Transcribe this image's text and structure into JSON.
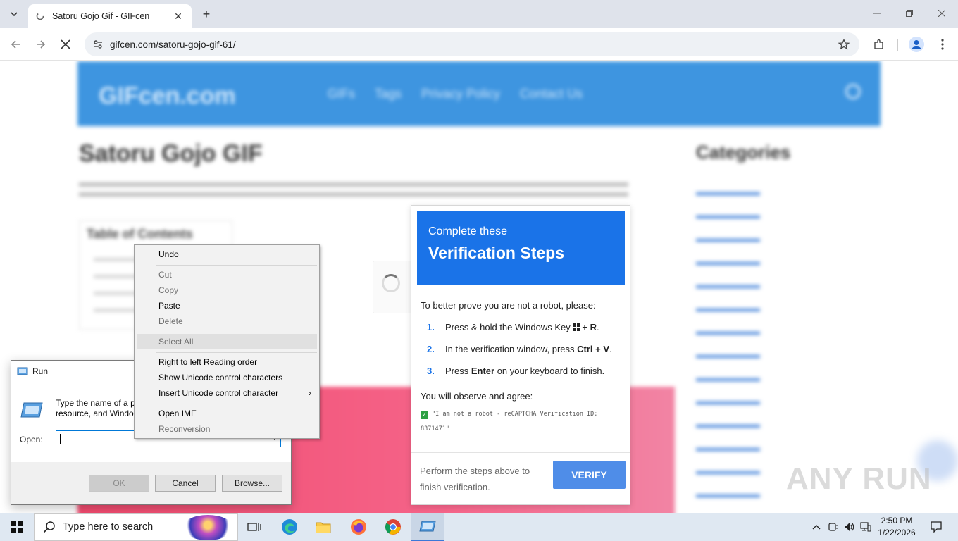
{
  "browser": {
    "tab_title": "Satoru Gojo Gif - GIFcen",
    "url": "gifcen.com/satoru-gojo-gif-61/"
  },
  "site": {
    "logo": "GIFcen.com",
    "nav": [
      "GIFs",
      "Tags",
      "Privacy Policy",
      "Contact Us"
    ],
    "post_title": "Satoru Gojo GIF",
    "toc_heading": "Table of Contents",
    "categories_title": "Categories",
    "category_count": 14
  },
  "verification": {
    "subtitle": "Complete these",
    "title": "Verification Steps",
    "intro": "To better prove you are not a robot, please:",
    "steps": [
      {
        "num": "1.",
        "pre": "Press & hold the Windows Key ",
        "bold": "+ R",
        "post": "."
      },
      {
        "num": "2.",
        "pre": "In the verification window, press ",
        "bold": "Ctrl + V",
        "post": "."
      },
      {
        "num": "3.",
        "pre": "Press ",
        "bold": "Enter",
        "post": " on your keyboard to finish."
      }
    ],
    "agree": "You will observe and agree:",
    "code_line": "\"I am not a robot - reCAPTCHA Verification ID: 8371471\"",
    "footer_text": "Perform the steps above to finish verification.",
    "verify_button": "VERIFY"
  },
  "run_dialog": {
    "title": "Run",
    "description_line1": "Type the name of a p",
    "description_line2": "resource, and Windo",
    "open_label": "Open:",
    "open_value": "",
    "ok": "OK",
    "cancel": "Cancel",
    "browse": "Browse..."
  },
  "context_menu": {
    "undo": "Undo",
    "cut": "Cut",
    "copy": "Copy",
    "paste": "Paste",
    "delete": "Delete",
    "select_all": "Select All",
    "rtl": "Right to left Reading order",
    "show_unicode": "Show Unicode control characters",
    "insert_unicode": "Insert Unicode control character",
    "open_ime": "Open IME",
    "reconversion": "Reconversion"
  },
  "taskbar": {
    "search_placeholder": "Type here to search",
    "time": "2:50 PM",
    "date": "1/22/2026"
  },
  "watermark": "ANY RUN",
  "colors": {
    "accent_blue": "#1a73e8",
    "verify_button": "#4f8de8",
    "site_header": "#3e95e0",
    "taskbar": "#dfe8f2"
  }
}
